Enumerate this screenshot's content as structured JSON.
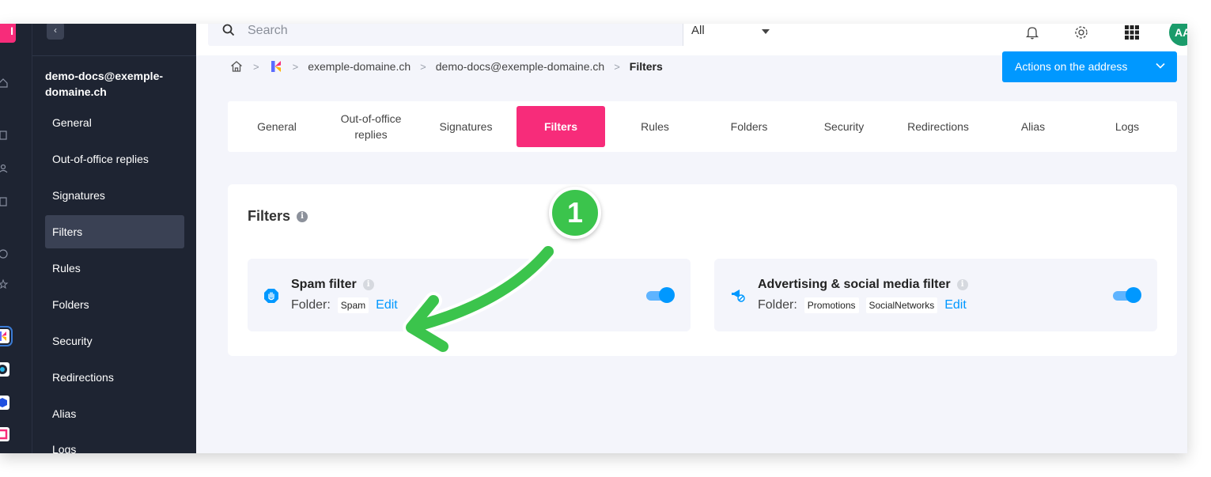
{
  "rail": {
    "logo_text": "I"
  },
  "sidebar": {
    "collapse_label": "‹",
    "account": "demo-docs@exemple-domaine.ch",
    "items": [
      {
        "label": "General"
      },
      {
        "label": "Out-of-office replies"
      },
      {
        "label": "Signatures"
      },
      {
        "label": "Filters",
        "active": true
      },
      {
        "label": "Rules"
      },
      {
        "label": "Folders"
      },
      {
        "label": "Security"
      },
      {
        "label": "Redirections"
      },
      {
        "label": "Alias"
      },
      {
        "label": "Logs"
      }
    ]
  },
  "topbar": {
    "search_placeholder": "Search",
    "scope_value": "All",
    "icons": [
      "bell-icon",
      "gear-icon",
      "apps-grid-icon"
    ],
    "avatar_initials": "AA"
  },
  "breadcrumb": {
    "items": [
      "exemple-domaine.ch",
      "demo-docs@exemple-domaine.ch"
    ],
    "current": "Filters"
  },
  "actions_button": {
    "label": "Actions on the address"
  },
  "tabs": [
    {
      "label": "General"
    },
    {
      "label": "Out-of-office replies"
    },
    {
      "label": "Signatures"
    },
    {
      "label": "Filters",
      "active": true
    },
    {
      "label": "Rules"
    },
    {
      "label": "Folders"
    },
    {
      "label": "Security"
    },
    {
      "label": "Redirections"
    },
    {
      "label": "Alias"
    },
    {
      "label": "Logs"
    }
  ],
  "filters_card": {
    "title": "Filters",
    "info": "i",
    "spam": {
      "name": "Spam filter",
      "info": "i",
      "folder_label": "Folder:",
      "folder_chip": "Spam",
      "edit_label": "Edit",
      "enabled": true
    },
    "advertising": {
      "name": "Advertising & social media filter",
      "info": "i",
      "folder_label": "Folder:",
      "folder_chips": [
        "Promotions",
        "SocialNetworks"
      ],
      "edit_label": "Edit",
      "enabled": true
    }
  },
  "annotation": {
    "step": "1",
    "color": "#3bc44c"
  },
  "colors": {
    "brand_pink": "#f72c7a",
    "primary_blue": "#0098ff",
    "sidebar_bg": "#1e2432"
  }
}
